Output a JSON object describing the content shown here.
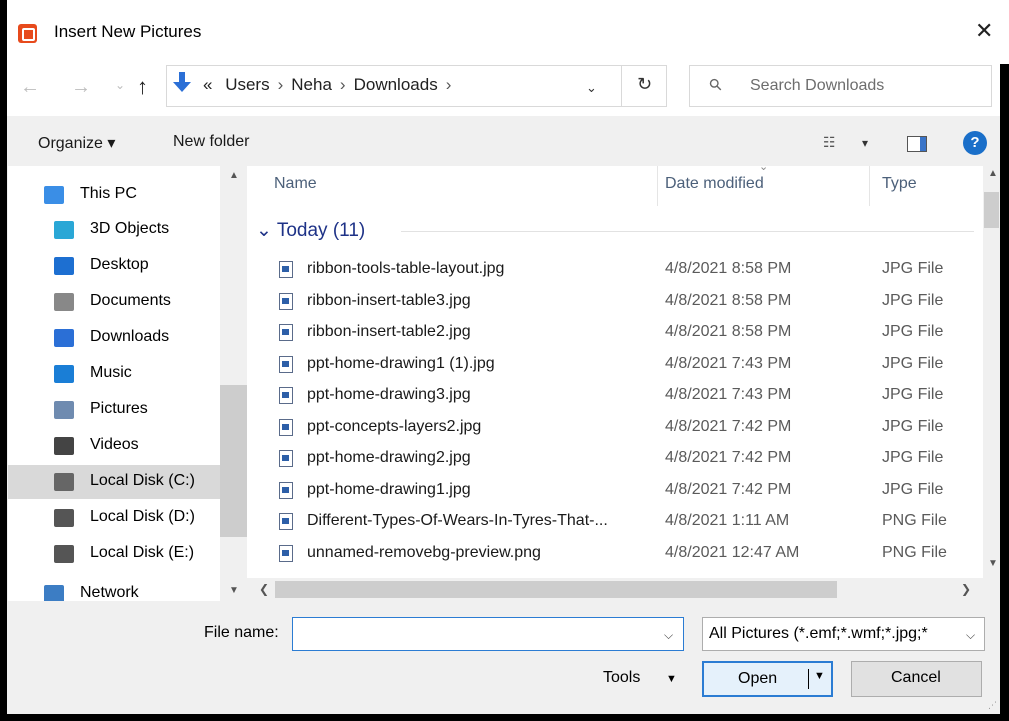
{
  "window": {
    "title": "Insert New Pictures",
    "close_glyph": "✕"
  },
  "nav": {
    "back_glyph": "←",
    "forward_glyph": "→",
    "recent_glyph": "⌄",
    "up_glyph": "↑",
    "breadcrumb": {
      "overflow": "«",
      "items": [
        "Users",
        "Neha",
        "Downloads"
      ],
      "sep": "›"
    },
    "address_dropdown_glyph": "⌄",
    "refresh_glyph": "↻",
    "search_placeholder": "Search Downloads"
  },
  "toolbar": {
    "organize": "Organize ▾",
    "new_folder": "New folder",
    "views_glyph": "☷",
    "views_dd": "▾",
    "help": "?"
  },
  "sidebar": {
    "items": [
      {
        "label": "This PC",
        "icon": "pc-icon",
        "color": "#3a8ee6"
      },
      {
        "label": "3D Objects",
        "icon": "3d-objects-icon",
        "color": "#2aa7d6"
      },
      {
        "label": "Desktop",
        "icon": "desktop-icon",
        "color": "#1d6fd1"
      },
      {
        "label": "Documents",
        "icon": "documents-icon",
        "color": "#888888"
      },
      {
        "label": "Downloads",
        "icon": "downloads-icon",
        "color": "#2b6fd6"
      },
      {
        "label": "Music",
        "icon": "music-icon",
        "color": "#1a7ed6"
      },
      {
        "label": "Pictures",
        "icon": "pictures-icon",
        "color": "#6f8bb0"
      },
      {
        "label": "Videos",
        "icon": "videos-icon",
        "color": "#444444"
      },
      {
        "label": "Local Disk (C:)",
        "icon": "local-disk-c-icon",
        "color": "#666666",
        "selected": true
      },
      {
        "label": "Local Disk (D:)",
        "icon": "local-disk-d-icon",
        "color": "#555555"
      },
      {
        "label": "Local Disk (E:)",
        "icon": "local-disk-e-icon",
        "color": "#555555"
      },
      {
        "label": "Network",
        "icon": "network-icon",
        "color": "#3c7dc4"
      }
    ]
  },
  "columns": {
    "name": "Name",
    "date": "Date modified",
    "type": "Type"
  },
  "group": {
    "label": "Today (11)",
    "glyph": "⌄"
  },
  "files": [
    {
      "name": "ribbon-tools-table-layout.jpg",
      "date": "4/8/2021 8:58 PM",
      "type": "JPG File"
    },
    {
      "name": "ribbon-insert-table3.jpg",
      "date": "4/8/2021 8:58 PM",
      "type": "JPG File"
    },
    {
      "name": "ribbon-insert-table2.jpg",
      "date": "4/8/2021 8:58 PM",
      "type": "JPG File"
    },
    {
      "name": "ppt-home-drawing1 (1).jpg",
      "date": "4/8/2021 7:43 PM",
      "type": "JPG File"
    },
    {
      "name": "ppt-home-drawing3.jpg",
      "date": "4/8/2021 7:43 PM",
      "type": "JPG File"
    },
    {
      "name": "ppt-concepts-layers2.jpg",
      "date": "4/8/2021 7:42 PM",
      "type": "JPG File"
    },
    {
      "name": "ppt-home-drawing2.jpg",
      "date": "4/8/2021 7:42 PM",
      "type": "JPG File"
    },
    {
      "name": "ppt-home-drawing1.jpg",
      "date": "4/8/2021 7:42 PM",
      "type": "JPG File"
    },
    {
      "name": "Different-Types-Of-Wears-In-Tyres-That-...",
      "date": "4/8/2021 1:11 AM",
      "type": "PNG File"
    },
    {
      "name": "unnamed-removebg-preview.png",
      "date": "4/8/2021 12:47 AM",
      "type": "PNG File"
    }
  ],
  "footer": {
    "file_name_label": "File name:",
    "file_name_value": "",
    "file_type": "All Pictures (*.emf;*.wmf;*.jpg;*",
    "tools": "Tools",
    "open": "Open",
    "cancel": "Cancel"
  }
}
